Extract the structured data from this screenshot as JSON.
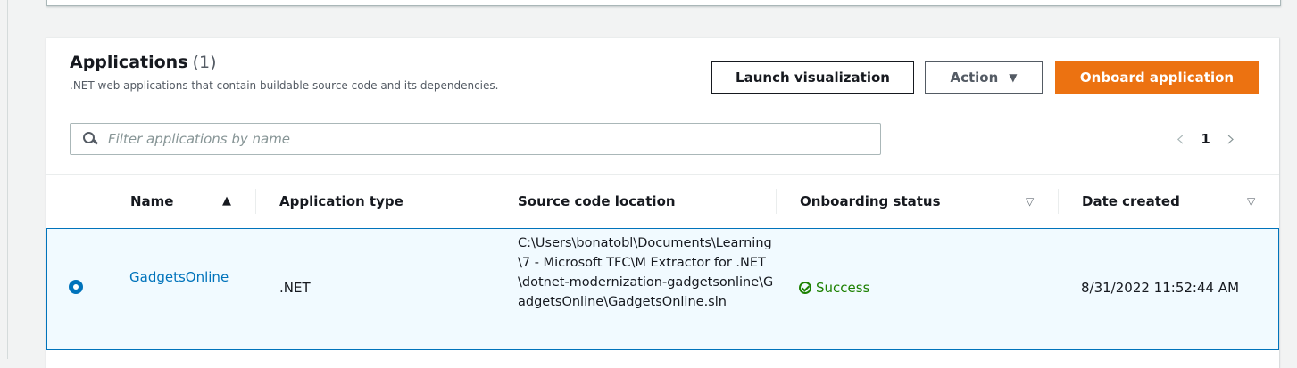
{
  "panel": {
    "title": "Applications",
    "count": "(1)",
    "description": ".NET web applications that contain buildable source code and its dependencies."
  },
  "toolbar": {
    "launch_label": "Launch visualization",
    "action_label": "Action",
    "onboard_label": "Onboard application"
  },
  "filter": {
    "placeholder": "Filter applications by name",
    "value": ""
  },
  "pagination": {
    "current_page": "1",
    "prev_icon": "chevron-left-icon",
    "next_icon": "chevron-right-icon"
  },
  "table": {
    "columns": [
      {
        "label": "Name",
        "sort": "ascending"
      },
      {
        "label": "Application type"
      },
      {
        "label": "Source code location"
      },
      {
        "label": "Onboarding status",
        "sort": "filterable"
      },
      {
        "label": "Date created",
        "sort": "filterable"
      }
    ],
    "rows": [
      {
        "selected": true,
        "name": "GadgetsOnline",
        "type": ".NET",
        "source": "C:\\Users\\bonatobl\\Documents\\Learning\\7 - Microsoft TFC\\M Extractor for .NET\\dotnet-modernization-gadgetsonline\\GadgetsOnline\\GadgetsOnline.sln",
        "status": "Success",
        "date": "8/31/2022 11:52:44 AM"
      }
    ]
  },
  "colors": {
    "accent": "#ec7211",
    "link": "#0073bb",
    "success": "#1d8102",
    "selected_row_bg": "#f1faff"
  }
}
